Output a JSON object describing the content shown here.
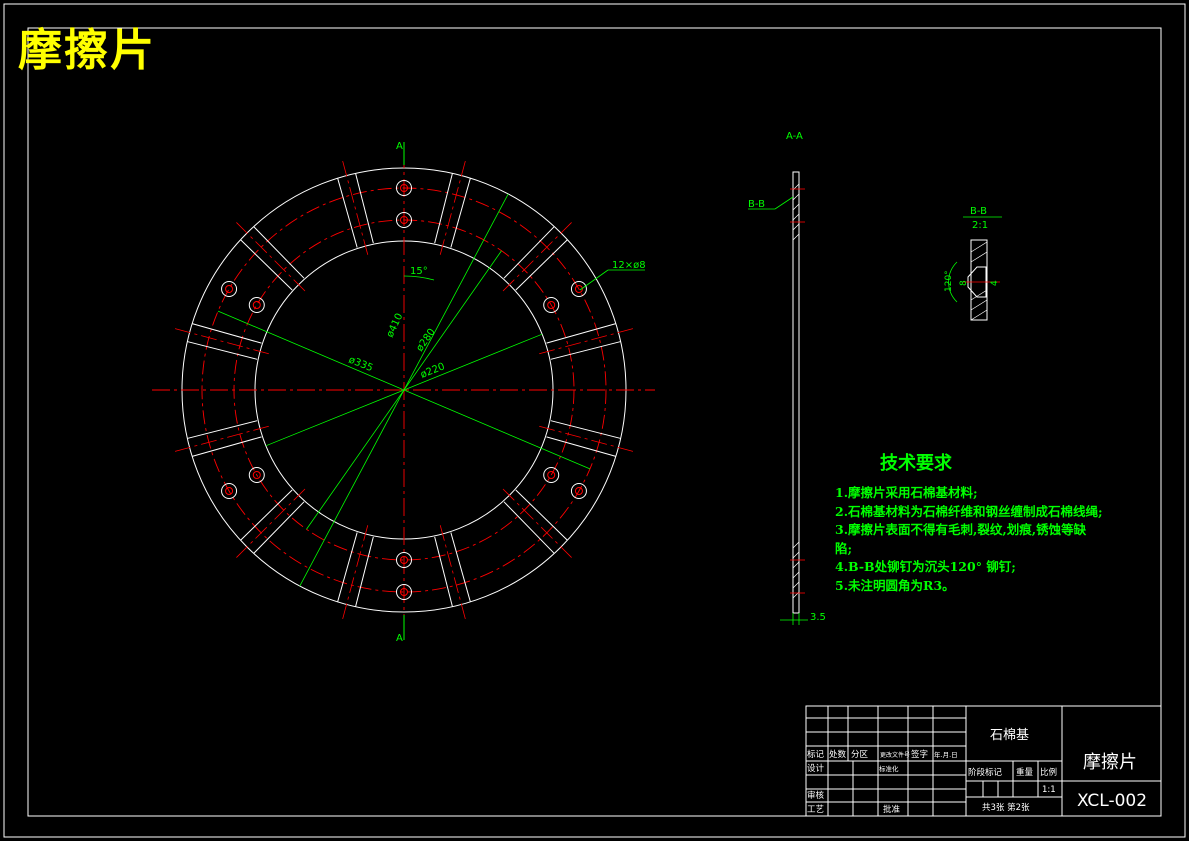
{
  "title": "摩擦片",
  "section_labels": {
    "top_marker": "A",
    "bottom_marker": "A",
    "aa": "A-A",
    "bb": "B-B",
    "bb_detail": "B-B",
    "bb_scale": "2:1"
  },
  "dimensions": {
    "d410": "ø410",
    "d335": "ø335",
    "d280": "ø280",
    "d220": "ø220",
    "angle15": "15°",
    "holes": "12×ø8",
    "angle120": "120°",
    "d8": "8",
    "d4": "4",
    "t35": "3.5"
  },
  "notes": {
    "heading": "技术要求",
    "items": [
      "1.摩擦片采用石棉基材料;",
      "2.石棉基材料为石棉纤维和钢丝缠制成石棉线绳;",
      "3.摩擦片表面不得有毛刺,裂纹,划痕,锈蚀等缺",
      "陷;",
      "4.B-B处铆钉为沉头120° 铆钉;",
      "5.未注明圆角为R3。"
    ]
  },
  "title_block": {
    "material": "石棉基",
    "part_name": "摩擦片",
    "drawing_no": "XCL-002",
    "scale": "1:1",
    "sheets": "共3张  第2张",
    "labels": {
      "mark": "标记",
      "count": "处数",
      "zone": "分区",
      "change_doc": "更改文件号",
      "sign": "签字",
      "date": "年.月.日",
      "design": "设计",
      "standard": "标准化",
      "review": "审核",
      "process": "工艺",
      "approve": "批准",
      "stage": "阶段标记",
      "weight": "重量",
      "ratio": "比例"
    }
  },
  "colors": {
    "background": "#000000",
    "outline": "#ffffff",
    "centerline": "#ff0000",
    "dimension": "#00ff00",
    "title": "#ffff00",
    "section_hatch": "#ffffff"
  }
}
